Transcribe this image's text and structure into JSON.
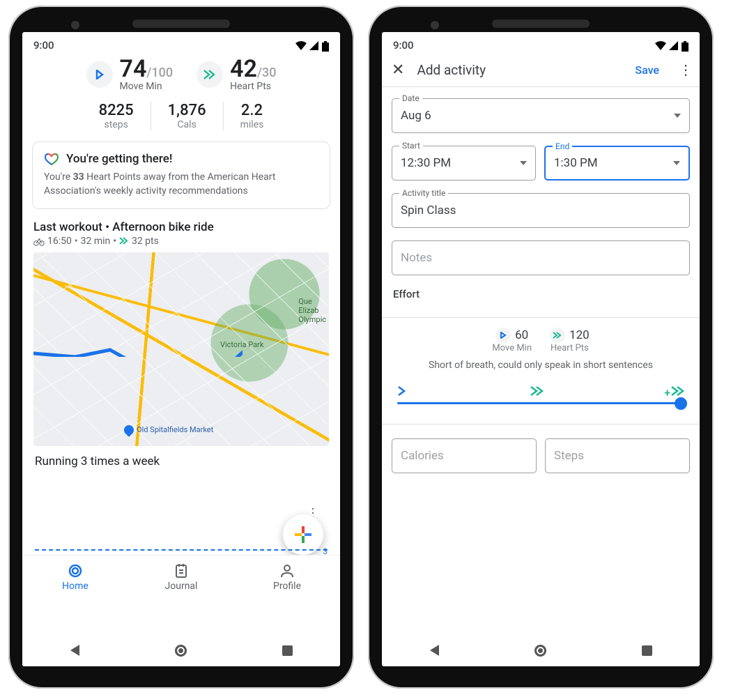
{
  "status": {
    "time": "9:00"
  },
  "phone1": {
    "goals": {
      "move": {
        "value": "74",
        "max": "/100",
        "label": "Move Min"
      },
      "heart": {
        "value": "42",
        "max": "/30",
        "label": "Heart Pts"
      }
    },
    "metrics": {
      "steps": {
        "value": "8225",
        "label": "steps"
      },
      "cals": {
        "value": "1,876",
        "label": "Cals"
      },
      "miles": {
        "value": "2.2",
        "label": "miles"
      }
    },
    "card": {
      "title": "You're getting there!",
      "body_pre": "You're ",
      "body_bold": "33",
      "body_post": " Heart Points away from the American Heart Association's weekly activity recommendations"
    },
    "workout": {
      "title": "Last workout • Afternoon bike ride",
      "time": "16:50",
      "duration": "32 min",
      "pts": "32 pts",
      "map_labels": {
        "victoria": "Victoria Park",
        "olympic": "Que\nElizab\nOlympic",
        "poi": "Old Spitalfields Market"
      }
    },
    "running": {
      "title": "Running 3 times a week",
      "count": "3"
    },
    "tabs": {
      "home": "Home",
      "journal": "Journal",
      "profile": "Profile"
    }
  },
  "phone2": {
    "appbar": {
      "title": "Add activity",
      "save": "Save"
    },
    "date": {
      "label": "Date",
      "value": "Aug 6"
    },
    "start": {
      "label": "Start",
      "value": "12:30 PM"
    },
    "end": {
      "label": "End",
      "value": "1:30 PM"
    },
    "title_field": {
      "label": "Activity title",
      "value": "Spin Class"
    },
    "notes": {
      "placeholder": "Notes"
    },
    "effort": {
      "section": "Effort",
      "move": {
        "value": "60",
        "label": "Move Min"
      },
      "heart": {
        "value": "120",
        "label": "Heart Pts"
      },
      "description": "Short of breath, could only speak in short sentences"
    },
    "calories": {
      "placeholder": "Calories"
    },
    "steps": {
      "placeholder": "Steps"
    }
  }
}
